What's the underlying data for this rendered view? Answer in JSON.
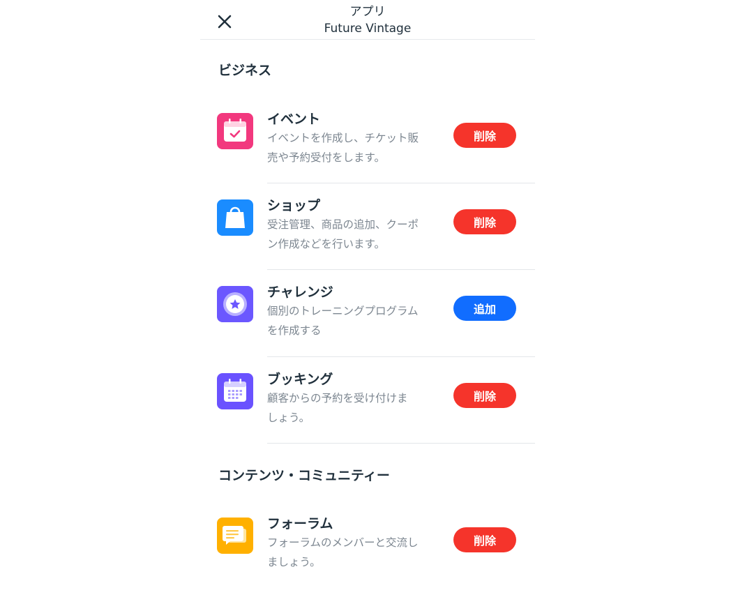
{
  "header": {
    "title": "アプリ",
    "subtitle": "Future Vintage",
    "close_icon": "close-icon"
  },
  "sections": [
    {
      "title": "ビジネス",
      "apps": [
        {
          "name": "イベント",
          "desc_line1": "イベントを作成し、チケット販",
          "desc_line2": "売や予約受付をします。",
          "action": "削除",
          "icon": "calendar-check-icon",
          "color": "#f2387e"
        },
        {
          "name": "ショップ",
          "desc_line1": "受注管理、商品の追加、クーポ",
          "desc_line2": "ン作成などを行います。",
          "action": "削除",
          "icon": "shopping-bag-icon",
          "color": "#1a8cff"
        },
        {
          "name": "チャレンジ",
          "desc_line1": "個別のトレーニングプログラム",
          "desc_line2": "を作成する",
          "action": "追加",
          "icon": "star-badge-icon",
          "color": "#6b57ff"
        },
        {
          "name": "ブッキング",
          "desc_line1": "顧客からの予約を受け付けま",
          "desc_line2": "しょう。",
          "action": "削除",
          "icon": "calendar-grid-icon",
          "color": "#6a52ff"
        }
      ]
    },
    {
      "title": "コンテンツ・コミュニティー",
      "apps": [
        {
          "name": "フォーラム",
          "desc_line1": "フォーラムのメンバーと交流し",
          "desc_line2": "ましょう。",
          "action": "削除",
          "icon": "chat-bubbles-icon",
          "color": "#ffb000"
        }
      ]
    }
  ],
  "colors": {
    "remove_button": "#f5342b",
    "add_button": "#116dff"
  }
}
